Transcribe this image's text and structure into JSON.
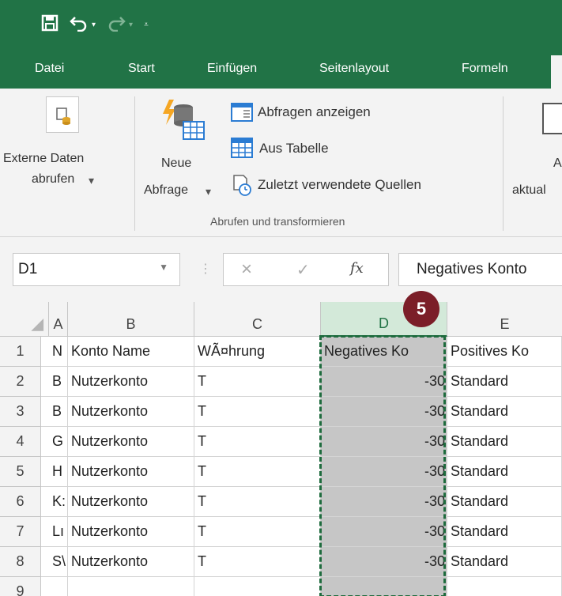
{
  "quick_access": {
    "save_icon": "save-icon",
    "undo_icon": "undo-icon",
    "redo_icon": "redo-icon",
    "customize_icon": "customize-qat-icon"
  },
  "tabs": [
    "Datei",
    "Start",
    "Einfügen",
    "Seitenlayout",
    "Formeln"
  ],
  "ribbon": {
    "external_data_line1": "Externe Daten",
    "external_data_line2": "abrufen",
    "new_query_line1": "Neue",
    "new_query_line2": "Abfrage",
    "show_queries": "Abfragen anzeigen",
    "from_table": "Aus Tabelle",
    "recent_sources": "Zuletzt verwendete Quellen",
    "group_label": "Abrufen und transformieren",
    "partial_right_1": "A",
    "partial_right_2": "aktual"
  },
  "formula_bar": {
    "name_box": "D1",
    "cancel_symbol": "×",
    "enter_symbol": "✓",
    "fx_symbol": "fx",
    "formula_value": "Negatives Konto"
  },
  "columns": [
    "A",
    "B",
    "C",
    "D",
    "E"
  ],
  "rows": [
    {
      "num": "1",
      "a": "N",
      "b": "Konto Name",
      "c": "WÃ¤hrung",
      "d": "Negatives Ko",
      "e": "Positives Ko"
    },
    {
      "num": "2",
      "a": "B",
      "b": "Nutzerkonto",
      "c": "T",
      "d": "-30",
      "e": "Standard"
    },
    {
      "num": "3",
      "a": "B",
      "b": "Nutzerkonto",
      "c": "T",
      "d": "-30",
      "e": "Standard"
    },
    {
      "num": "4",
      "a": "G",
      "b": "Nutzerkonto",
      "c": "T",
      "d": "-30",
      "e": "Standard"
    },
    {
      "num": "5",
      "a": "H",
      "b": "Nutzerkonto",
      "c": "T",
      "d": "-30",
      "e": "Standard"
    },
    {
      "num": "6",
      "a": "K:",
      "b": "Nutzerkonto",
      "c": "T",
      "d": "-30",
      "e": "Standard"
    },
    {
      "num": "7",
      "a": "Lı",
      "b": "Nutzerkonto",
      "c": "T",
      "d": "-30",
      "e": "Standard"
    },
    {
      "num": "8",
      "a": "S\\",
      "b": "Nutzerkonto",
      "c": "T",
      "d": "-30",
      "e": "Standard"
    },
    {
      "num": "9",
      "a": "",
      "b": "",
      "c": "",
      "d": "",
      "e": ""
    }
  ],
  "step_badge": "5",
  "colors": {
    "excel_green": "#217346",
    "badge": "#7b1e28",
    "selection_fill": "#c6c6c6"
  }
}
